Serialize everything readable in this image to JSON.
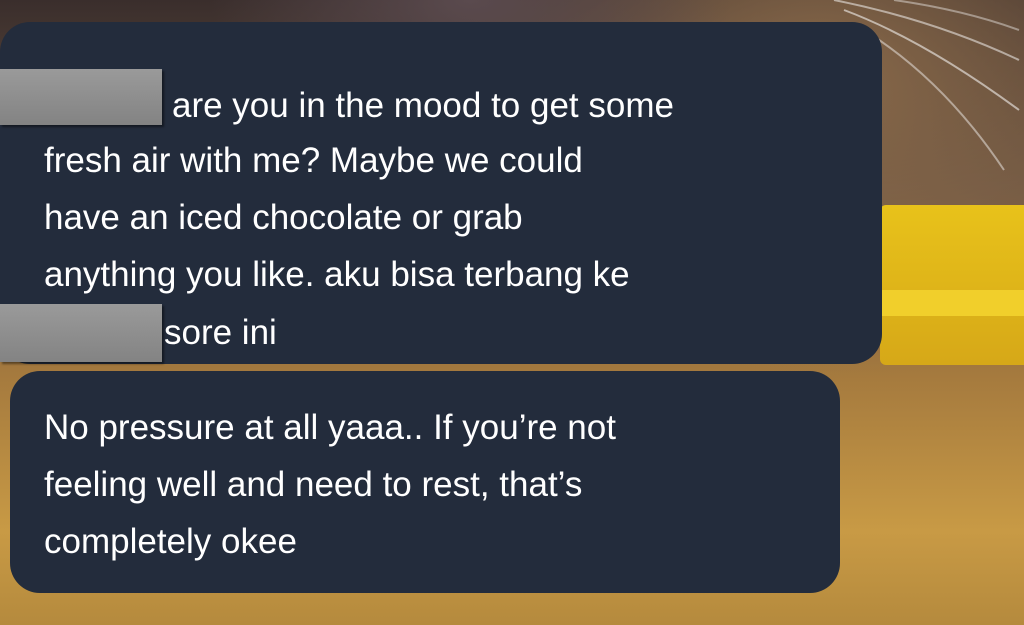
{
  "messages": [
    {
      "lines": [
        "are you in the mood to get some",
        "fresh air with me? Maybe we could",
        "have an iced chocolate or grab",
        "anything you like. aku bisa terbang ke",
        "sore ini"
      ]
    },
    {
      "lines": [
        "No pressure at all yaaa.. If you’re not",
        "feeling well and need to rest, that’s",
        "completely okee"
      ]
    }
  ],
  "colors": {
    "bubble_background": "#232c3c",
    "text": "#ffffff",
    "redaction": "#8c8c8c"
  }
}
